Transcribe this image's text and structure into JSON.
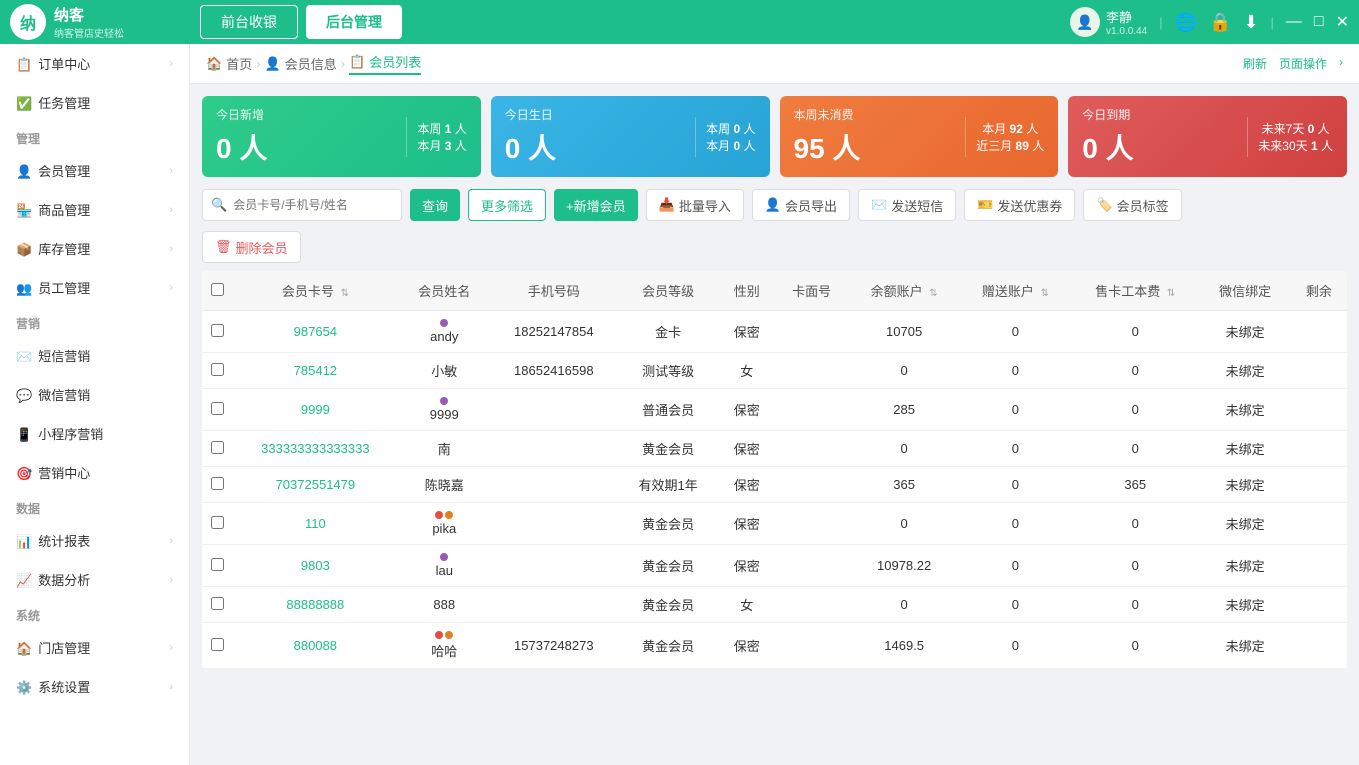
{
  "app": {
    "name": "纳客",
    "subtitle": "纳客管店史轻松",
    "version": "v1.0.0.44"
  },
  "titlebar": {
    "tab_frontend": "前台收银",
    "tab_backend": "后台管理",
    "user_name": "李静",
    "version": "v1.0.0.44",
    "btn_refresh": "刷新",
    "btn_page_op": "页面操作"
  },
  "sidebar": {
    "sections": [
      {
        "id": "order",
        "items": [
          {
            "id": "order-center",
            "label": "订单中心",
            "icon": "📋",
            "has_child": true
          }
        ]
      },
      {
        "id": "task",
        "items": [
          {
            "id": "task-mgmt",
            "label": "任务管理",
            "icon": "✅",
            "has_child": false
          }
        ]
      },
      {
        "id": "mgmt-section",
        "label": "管理",
        "items": [
          {
            "id": "member-mgmt",
            "label": "会员管理",
            "icon": "👤",
            "has_child": true
          },
          {
            "id": "goods-mgmt",
            "label": "商品管理",
            "icon": "🏪",
            "has_child": true
          },
          {
            "id": "inventory-mgmt",
            "label": "库存管理",
            "icon": "📦",
            "has_child": true
          },
          {
            "id": "staff-mgmt",
            "label": "员工管理",
            "icon": "👥",
            "has_child": true
          }
        ]
      },
      {
        "id": "marketing-section",
        "label": "营销",
        "items": [
          {
            "id": "sms-marketing",
            "label": "短信营销",
            "icon": "✉️",
            "has_child": false
          },
          {
            "id": "wechat-marketing",
            "label": "微信营销",
            "icon": "💬",
            "has_child": false
          },
          {
            "id": "miniapp-marketing",
            "label": "小程序营销",
            "icon": "📱",
            "has_child": false
          },
          {
            "id": "marketing-center",
            "label": "营销中心",
            "icon": "🎯",
            "has_child": false
          }
        ]
      },
      {
        "id": "data-section",
        "label": "数据",
        "items": [
          {
            "id": "stats-report",
            "label": "统计报表",
            "icon": "📊",
            "has_child": true
          },
          {
            "id": "data-analysis",
            "label": "数据分析",
            "icon": "📈",
            "has_child": true
          }
        ]
      },
      {
        "id": "system-section",
        "label": "系统",
        "items": [
          {
            "id": "store-mgmt",
            "label": "门店管理",
            "icon": "🏠",
            "has_child": true
          },
          {
            "id": "sys-settings",
            "label": "系统设置",
            "icon": "⚙️",
            "has_child": true
          }
        ]
      }
    ]
  },
  "breadcrumb": {
    "items": [
      {
        "label": "首页",
        "icon": "🏠",
        "active": false
      },
      {
        "label": "会员信息",
        "icon": "👤",
        "active": false
      },
      {
        "label": "会员列表",
        "icon": "📋",
        "active": true
      }
    ],
    "btn_refresh": "刷新",
    "btn_page_op": "页面操作"
  },
  "stats": {
    "new_today": {
      "label": "今日新增",
      "value": "0 人",
      "week_label": "本周",
      "week_value": "1 人",
      "month_label": "本月",
      "month_value": "3 人"
    },
    "birthday_today": {
      "label": "今日生日",
      "value": "0 人",
      "week_label": "本周",
      "week_value": "0 人",
      "month_label": "本月",
      "month_value": "0 人"
    },
    "no_consume_week": {
      "label": "本周未消费",
      "value": "95 人",
      "month_label": "本月",
      "month_value": "92 人",
      "three_months_label": "近三月",
      "three_months_value": "89 人"
    },
    "expire_today": {
      "label": "今日到期",
      "value": "0 人",
      "days7_label": "未来7天",
      "days7_value": "0 人",
      "days30_label": "未来30天",
      "days30_value": "1 人"
    }
  },
  "toolbar": {
    "search_placeholder": "会员卡号/手机号/姓名",
    "btn_query": "查询",
    "btn_more_filter": "更多筛选",
    "btn_add_member": "+新增会员",
    "btn_batch_import": "批量导入",
    "btn_export": "会员导出",
    "btn_send_sms": "发送短信",
    "btn_send_coupon": "发送优惠券",
    "btn_member_tag": "会员标签",
    "btn_delete": "删除会员"
  },
  "table": {
    "columns": [
      "会员卡号",
      "会员姓名",
      "手机号码",
      "会员等级",
      "性别",
      "卡面号",
      "余额账户",
      "赠送账户",
      "售卡工本费",
      "微信绑定",
      "剩余"
    ],
    "rows": [
      {
        "id": "987654",
        "name": "andy",
        "phone": "18252147854",
        "level": "金卡",
        "gender": "保密",
        "card_face": "",
        "balance": "10705",
        "gift": "0",
        "cost": "0",
        "wechat": "未绑定",
        "dots": [
          "purple"
        ]
      },
      {
        "id": "785412",
        "name": "小敏",
        "phone": "18652416598",
        "level": "测试等级",
        "gender": "女",
        "card_face": "",
        "balance": "0",
        "gift": "0",
        "cost": "0",
        "wechat": "未绑定",
        "dots": []
      },
      {
        "id": "9999",
        "name": "9999",
        "phone": "",
        "level": "普通会员",
        "gender": "保密",
        "card_face": "",
        "balance": "285",
        "gift": "0",
        "cost": "0",
        "wechat": "未绑定",
        "dots": [
          "purple"
        ]
      },
      {
        "id": "333333333333333",
        "name": "南",
        "phone": "",
        "level": "黄金会员",
        "gender": "保密",
        "card_face": "",
        "balance": "0",
        "gift": "0",
        "cost": "0",
        "wechat": "未绑定",
        "dots": []
      },
      {
        "id": "70372551479",
        "name": "陈晓嘉",
        "phone": "",
        "level": "有效期1年",
        "gender": "保密",
        "card_face": "",
        "balance": "365",
        "gift": "0",
        "cost": "365",
        "wechat": "未绑定",
        "dots": []
      },
      {
        "id": "110",
        "name": "pika",
        "phone": "",
        "level": "黄金会员",
        "gender": "保密",
        "card_face": "",
        "balance": "0",
        "gift": "0",
        "cost": "0",
        "wechat": "未绑定",
        "dots": [
          "red",
          "orange"
        ]
      },
      {
        "id": "9803",
        "name": "lau",
        "phone": "",
        "level": "黄金会员",
        "gender": "保密",
        "card_face": "",
        "balance": "10978.22",
        "gift": "0",
        "cost": "0",
        "wechat": "未绑定",
        "dots": [
          "purple"
        ]
      },
      {
        "id": "88888888",
        "name": "888",
        "phone": "",
        "level": "黄金会员",
        "gender": "女",
        "card_face": "",
        "balance": "0",
        "gift": "0",
        "cost": "0",
        "wechat": "未绑定",
        "dots": []
      },
      {
        "id": "880088",
        "name": "哈哈",
        "phone": "15737248273",
        "level": "黄金会员",
        "gender": "保密",
        "card_face": "",
        "balance": "1469.5",
        "gift": "0",
        "cost": "0",
        "wechat": "未绑定",
        "dots": [
          "red",
          "orange"
        ]
      }
    ]
  }
}
